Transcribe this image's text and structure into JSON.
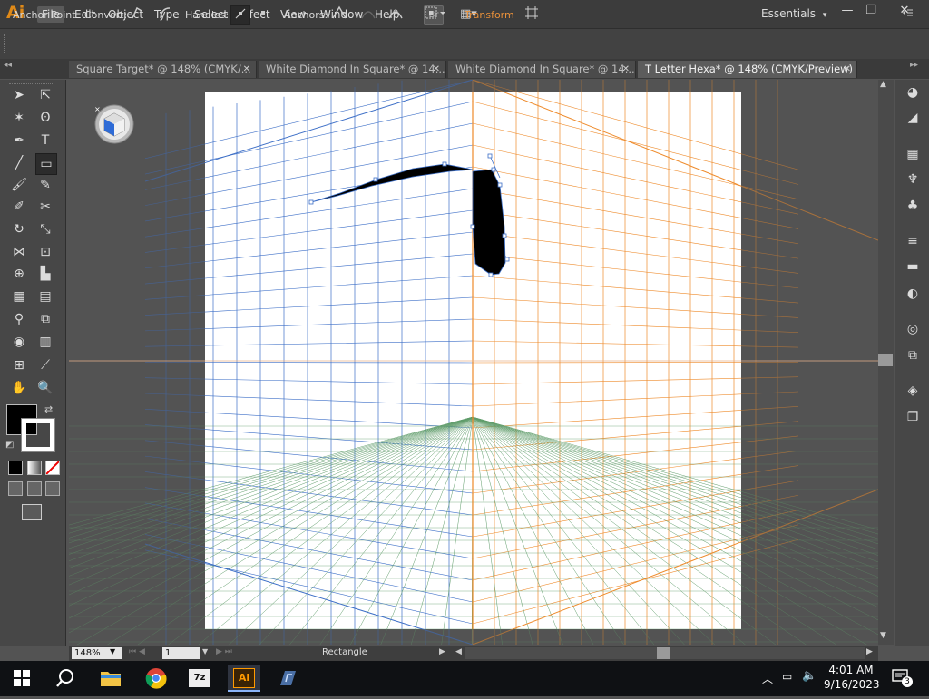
{
  "app": {
    "logo": "Ai"
  },
  "menu": [
    "File",
    "Edit",
    "Object",
    "Type",
    "Select",
    "Effect",
    "View",
    "Window",
    "Help"
  ],
  "menubar_buttons": {
    "bridge": "Br",
    "arrange": "▦▾"
  },
  "workspace": {
    "label": "Essentials",
    "arrow": "▾"
  },
  "window_controls": {
    "minimize": "—",
    "restore": "❐",
    "close": "✕"
  },
  "control_bar": {
    "tool_name": "Anchor Point",
    "convert_label": "Convert:",
    "handles_label": "Handles:",
    "anchors_label": "Anchors:",
    "transform_label": "Transform"
  },
  "tabs": [
    {
      "label": "Square Target* @ 148% (CMYK/...",
      "close": "✕"
    },
    {
      "label": "White Diamond In Square* @ 14...",
      "close": "✕"
    },
    {
      "label": "White Diamond In Square* @ 14...",
      "close": "✕"
    },
    {
      "label": "T Letter Hexa* @ 148% (CMYK/Preview)",
      "close": "✕"
    }
  ],
  "status": {
    "zoom": "148%",
    "page": "1",
    "current_tool": "Rectangle"
  },
  "taskbar": {
    "time": "4:01 AM",
    "date": "9/16/2023",
    "notification_count": "3",
    "ai_label": "Ai"
  },
  "colors": {
    "blue_grid": "#3d6fc7",
    "orange_grid": "#ee8a2a",
    "green_grid": "#5f9c6a",
    "accent": "#e08a18"
  }
}
